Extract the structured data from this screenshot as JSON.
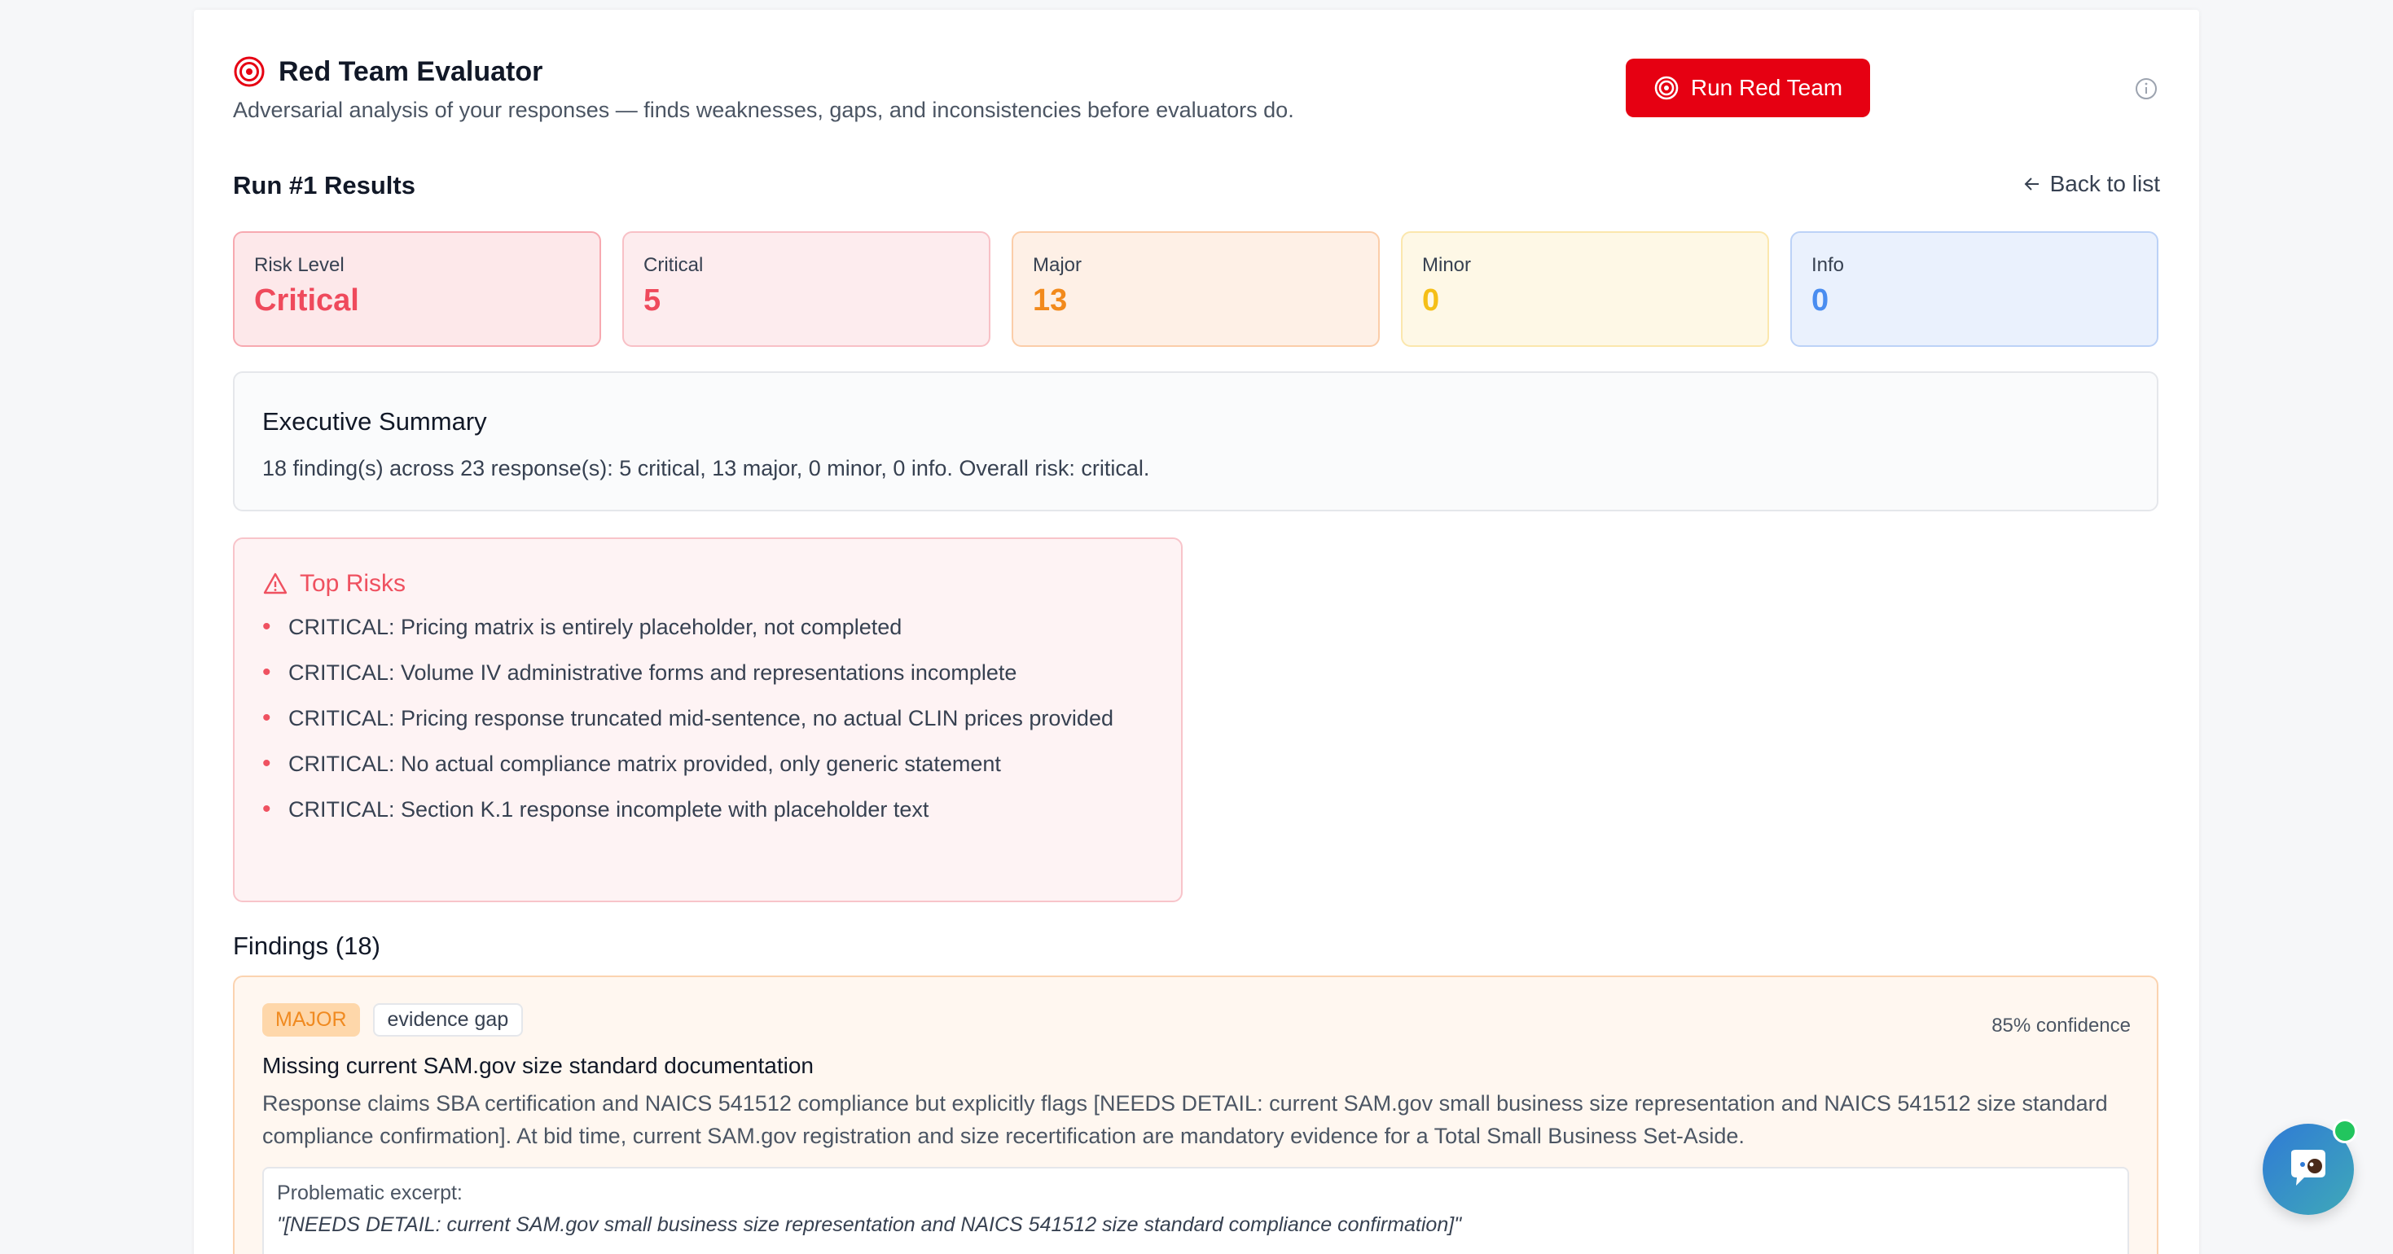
{
  "header": {
    "title": "Red Team Evaluator",
    "subtitle": "Adversarial analysis of your responses — finds weaknesses, gaps, and inconsistencies before evaluators do.",
    "run_button_label": "Run Red Team"
  },
  "results": {
    "title": "Run #1 Results",
    "back_label": "Back to list"
  },
  "stats": {
    "risk_level": {
      "label": "Risk Level",
      "value": "Critical"
    },
    "critical": {
      "label": "Critical",
      "value": "5"
    },
    "major": {
      "label": "Major",
      "value": "13"
    },
    "minor": {
      "label": "Minor",
      "value": "0"
    },
    "info": {
      "label": "Info",
      "value": "0"
    }
  },
  "executive_summary": {
    "title": "Executive Summary",
    "text": "18 finding(s) across 23 response(s): 5 critical, 13 major, 0 minor, 0 info. Overall risk: critical."
  },
  "top_risks": {
    "title": "Top Risks",
    "items": [
      "CRITICAL: Pricing matrix is entirely placeholder, not completed",
      "CRITICAL: Volume IV administrative forms and representations incomplete",
      "CRITICAL: Pricing response truncated mid-sentence, no actual CLIN prices provided",
      "CRITICAL: No actual compliance matrix provided, only generic statement",
      "CRITICAL: Section K.1 response incomplete with placeholder text"
    ]
  },
  "findings": {
    "title": "Findings (18)",
    "items": [
      {
        "severity": "MAJOR",
        "category": "evidence gap",
        "confidence": "85% confidence",
        "title": "Missing current SAM.gov size standard documentation",
        "description": "Response claims SBA certification and NAICS 541512 compliance but explicitly flags [NEEDS DETAIL: current SAM.gov small business size representation and NAICS 541512 size standard compliance confirmation]. At bid time, current SAM.gov registration and size recertification are mandatory evidence for a Total Small Business Set-Aside.",
        "excerpt_label": "Problematic excerpt:",
        "excerpt": "\"[NEEDS DETAIL: current SAM.gov small business size representation and NAICS 541512 size standard compliance confirmation]\""
      }
    ]
  },
  "colors": {
    "primary_red": "#e60012",
    "critical": "#ef4a5c",
    "major": "#f28a1c",
    "minor": "#f5bf17",
    "info": "#4a8df0"
  },
  "icons": {
    "title": "target-icon",
    "run_button": "target-icon",
    "info": "info-circle-icon",
    "back": "arrow-left-icon",
    "top_risks": "warning-triangle-icon",
    "chat": "chat-bot-icon"
  }
}
